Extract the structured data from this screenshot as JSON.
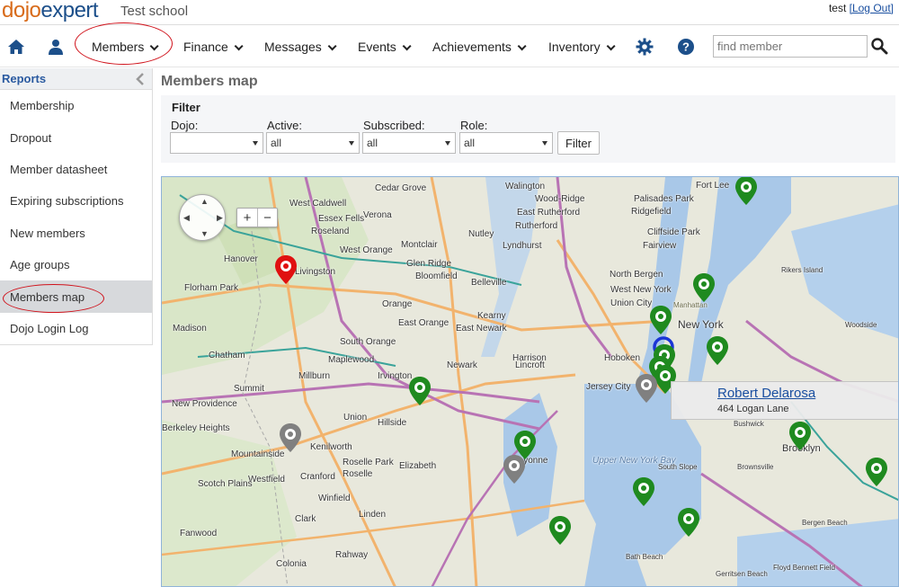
{
  "header": {
    "logo_part1": "dojo",
    "logo_part2": "expert",
    "school": "Test school",
    "user": "test",
    "logout": "[Log Out]"
  },
  "nav": {
    "items": [
      {
        "label": "Members"
      },
      {
        "label": "Finance"
      },
      {
        "label": "Messages"
      },
      {
        "label": "Events"
      },
      {
        "label": "Achievements"
      },
      {
        "label": "Inventory"
      }
    ],
    "search_placeholder": "find member"
  },
  "sidebar": {
    "title": "Reports",
    "items": [
      {
        "label": "Membership"
      },
      {
        "label": "Dropout"
      },
      {
        "label": "Member datasheet"
      },
      {
        "label": "Expiring subscriptions"
      },
      {
        "label": "New members"
      },
      {
        "label": "Age groups"
      },
      {
        "label": "Members map"
      },
      {
        "label": "Dojo Login Log"
      }
    ],
    "active_item": "Members map"
  },
  "page": {
    "title": "Members map"
  },
  "filter": {
    "title": "Filter",
    "dojo_label": "Dojo:",
    "dojo_value": "",
    "active_label": "Active:",
    "active_value": "all",
    "subscribed_label": "Subscribed:",
    "subscribed_value": "all",
    "role_label": "Role:",
    "role_value": "all",
    "button": "Filter"
  },
  "map": {
    "zoom_in": "+",
    "zoom_out": "−",
    "labels": [
      "West Caldwell",
      "Cedar Grove",
      "Walington",
      "Wood-Ridge",
      "East Rutherford",
      "Rutherford",
      "Palisades Park",
      "Fort Lee",
      "Ridgefield",
      "Cliffside Park",
      "Fairview",
      "Essex Fells",
      "Roseland",
      "Verona",
      "Nutley",
      "Lyndhurst",
      "Hanover",
      "West Orange",
      "Montclair",
      "Glen Ridge",
      "Bloomfield",
      "Belleville",
      "Florham Park",
      "Livingston",
      "North Bergen",
      "West New York",
      "Union City",
      "New York",
      "Manhattan",
      "Orange",
      "East Orange",
      "Kearny",
      "East Newark",
      "Madison",
      "South Orange",
      "Maplewood",
      "Harrison",
      "Chatham",
      "Millburn",
      "Irvington",
      "Newark",
      "Lincroft",
      "Hoboken",
      "Jersey City",
      "Summit",
      "New Providence",
      "Union",
      "Hillside",
      "Elizabeth",
      "Kenilworth",
      "Roselle",
      "Roselle Park",
      "Mountainside",
      "Westfield",
      "Cranford",
      "Scotch Plains",
      "Winfield",
      "Clark",
      "Linden",
      "Fanwood",
      "Colonia",
      "Rahway",
      "Bayonne",
      "Upper New York Bay",
      "Brooklyn",
      "Rikers Island",
      "Bushwick",
      "Brownsville",
      "South Slope",
      "Bergen Beach",
      "Floyd Bennett Field",
      "Bath Beach",
      "Gerritsen Beach",
      "Woodside",
      "Berkeley Heights"
    ],
    "tooltip_name": "Robert Delarosa",
    "tooltip_address": "464 Logan Lane",
    "marker_colors": {
      "member": "#1f8a1f",
      "inactive": "#808080",
      "dojo": "#e01010",
      "selected": "#1a35d6"
    }
  }
}
